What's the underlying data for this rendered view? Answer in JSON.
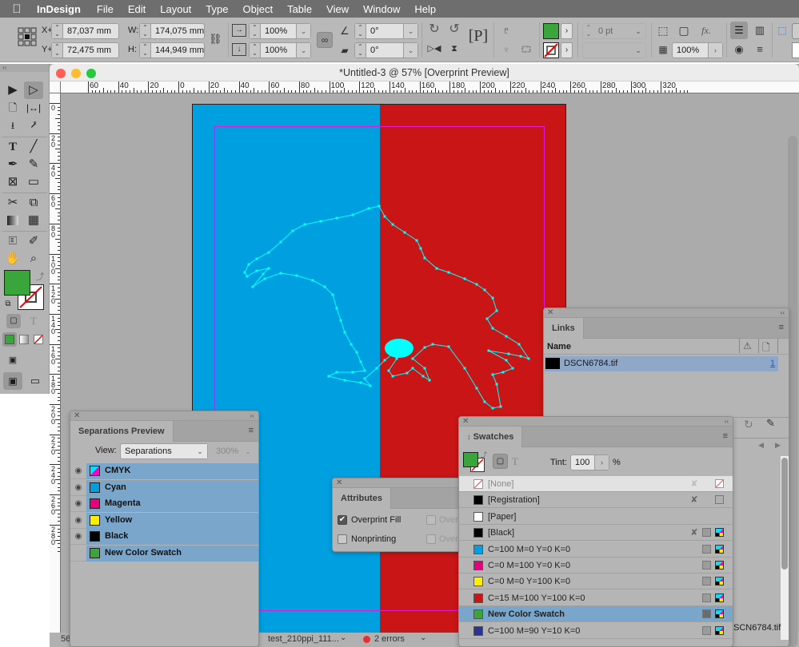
{
  "menubar": {
    "apple_icon": "",
    "app": "InDesign",
    "items": [
      "File",
      "Edit",
      "Layout",
      "Type",
      "Object",
      "Table",
      "View",
      "Window",
      "Help"
    ]
  },
  "control": {
    "x_label": "X+",
    "x_value": "87,037 mm",
    "y_label": "Y+",
    "y_value": "72,475 mm",
    "w_label": "W:",
    "w_value": "174,075 mm",
    "h_label": "H:",
    "h_value": "144,949 mm",
    "scale_x": "100%",
    "scale_y": "100%",
    "rotation": "0°",
    "shear": "0°",
    "stroke_weight": "0 pt",
    "opacity": "100%",
    "fill_color": "#3aa53a"
  },
  "document": {
    "title": "*Untitled-3 @ 57% [Overprint Preview]",
    "hruler_labels": [
      "60",
      "40",
      "20",
      "0",
      "20",
      "40",
      "60",
      "80",
      "100",
      "120",
      "140",
      "160",
      "180",
      "200",
      "220",
      "240",
      "260",
      "280",
      "300",
      "320"
    ],
    "vruler_labels": [
      "0",
      "20",
      "40",
      "60",
      "80",
      "100",
      "120",
      "140",
      "160",
      "180",
      "200",
      "220",
      "240",
      "260",
      "280"
    ],
    "page_left_color": "#009fe0",
    "page_right_color": "#c91515",
    "path_color": "#00ffff",
    "zoom_status": "56",
    "file_dropdown": "test_210ppi_111...",
    "errors": "2 errors"
  },
  "tools": {
    "fill_color": "#3aa53a"
  },
  "separations": {
    "title": "Separations Preview",
    "view_label": "View:",
    "view_value": "Separations",
    "percent": "300%",
    "rows": [
      {
        "name": "CMYK",
        "color": "cmyk",
        "visible": true
      },
      {
        "name": "Cyan",
        "color": "#009fe0",
        "visible": true
      },
      {
        "name": "Magenta",
        "color": "#e4007f",
        "visible": true
      },
      {
        "name": "Yellow",
        "color": "#ffee00",
        "visible": true
      },
      {
        "name": "Black",
        "color": "#000000",
        "visible": true
      },
      {
        "name": "New Color Swatch",
        "color": "#3aa53a",
        "visible": false
      }
    ]
  },
  "attributes": {
    "title": "Attributes",
    "overprint_fill": "Overprint Fill",
    "overprint_fill_checked": true,
    "nonprinting": "Nonprinting",
    "nonprinting_checked": false,
    "overprint_stroke": "Overp",
    "overprint_gap": "Overp"
  },
  "links": {
    "title": "Links",
    "col_name": "Name",
    "rows": [
      {
        "name": "DSCN6784.tif",
        "page": "1"
      }
    ],
    "footer_name": "SCN6784.tif"
  },
  "swatches": {
    "title": "Swatches",
    "tint_label": "Tint:",
    "tint_value": "100",
    "percent": "%",
    "rows": [
      {
        "name": "[None]",
        "color": "none",
        "selected": false
      },
      {
        "name": "[Registration]",
        "color": "#000000",
        "selected": false
      },
      {
        "name": "[Paper]",
        "color": "#ffffff",
        "selected": false
      },
      {
        "name": "[Black]",
        "color": "#000000",
        "selected": false
      },
      {
        "name": "C=100 M=0 Y=0 K=0",
        "color": "#009fe0",
        "selected": false
      },
      {
        "name": "C=0 M=100 Y=0 K=0",
        "color": "#e4007f",
        "selected": false
      },
      {
        "name": "C=0 M=0 Y=100 K=0",
        "color": "#ffee00",
        "selected": false
      },
      {
        "name": "C=15 M=100 Y=100 K=0",
        "color": "#c91515",
        "selected": false
      },
      {
        "name": "New Color Swatch",
        "color": "#3aa53a",
        "selected": true
      },
      {
        "name": "C=100 M=90 Y=10 K=0",
        "color": "#2a3590",
        "selected": false
      }
    ]
  }
}
